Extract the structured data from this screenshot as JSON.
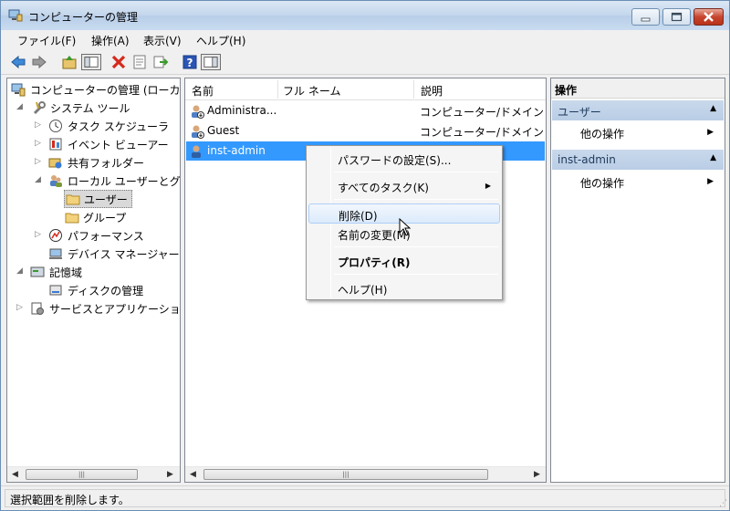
{
  "window": {
    "title": "コンピューターの管理"
  },
  "menu": [
    "ファイル(F)",
    "操作(A)",
    "表示(V)",
    "ヘルプ(H)"
  ],
  "toolbar": [
    "back-icon",
    "forward-icon",
    "up-folder-icon",
    "show-tree-icon",
    "delete-icon",
    "properties-icon",
    "export-icon",
    "help-icon",
    "action-pane-icon"
  ],
  "tree": {
    "items": [
      {
        "label": "コンピューターの管理 (ローカ",
        "icon": "computer-icon",
        "twisty": ""
      },
      {
        "label": "システム ツール",
        "icon": "tools-icon",
        "twisty": "◢"
      },
      {
        "label": "タスク スケジューラ",
        "icon": "clock-icon",
        "twisty": "▷"
      },
      {
        "label": "イベント ビューアー",
        "icon": "event-viewer-icon",
        "twisty": "▷"
      },
      {
        "label": "共有フォルダー",
        "icon": "shared-folder-icon",
        "twisty": "▷"
      },
      {
        "label": "ローカル ユーザーとグ",
        "icon": "users-icon",
        "twisty": "◢"
      },
      {
        "label": "ユーザー",
        "icon": "folder-icon",
        "twisty": ""
      },
      {
        "label": "グループ",
        "icon": "folder-icon",
        "twisty": ""
      },
      {
        "label": "パフォーマンス",
        "icon": "performance-icon",
        "twisty": "▷"
      },
      {
        "label": "デバイス マネージャー",
        "icon": "device-manager-icon",
        "twisty": ""
      },
      {
        "label": "記憶域",
        "icon": "storage-icon",
        "twisty": "◢"
      },
      {
        "label": "ディスクの管理",
        "icon": "disk-icon",
        "twisty": ""
      },
      {
        "label": "サービスとアプリケーショ",
        "icon": "services-icon",
        "twisty": "▷"
      }
    ]
  },
  "list": {
    "columns": [
      "名前",
      "フル ネーム",
      "説明"
    ],
    "rows": [
      {
        "name": "Administra...",
        "fullname": "",
        "desc": "コンピューター/ドメイン"
      },
      {
        "name": "Guest",
        "fullname": "",
        "desc": "コンピューター/ドメイン"
      },
      {
        "name": "inst-admin",
        "fullname": "",
        "desc": ""
      }
    ]
  },
  "actions": {
    "header": "操作",
    "sections": [
      {
        "title": "ユーザー",
        "item": "他の操作"
      },
      {
        "title": "inst-admin",
        "item": "他の操作"
      }
    ]
  },
  "context_menu": {
    "items": [
      "パスワードの設定(S)...",
      "すべてのタスク(K)",
      "削除(D)",
      "名前の変更(M)",
      "プロパティ(R)",
      "ヘルプ(H)"
    ]
  },
  "status": "選択範囲を削除します。",
  "colors": {
    "selection": "#3399ff",
    "delete": "#d42a1e",
    "section": "#c9d9ec"
  }
}
